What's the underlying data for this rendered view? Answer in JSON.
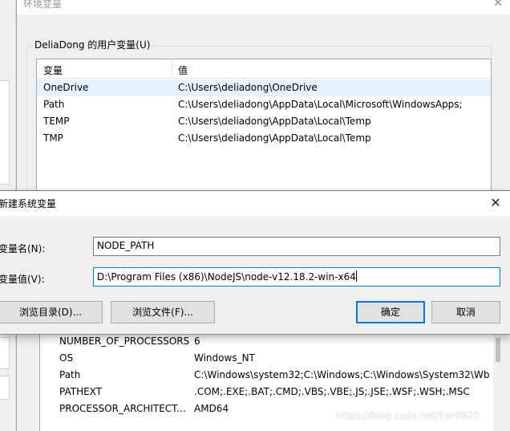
{
  "env_window": {
    "title": "环境变量",
    "close_glyph": "✕",
    "user_group_label": "DeliaDong 的用户变量(U)",
    "columns": {
      "name": "变量",
      "value": "值"
    },
    "user_vars": [
      {
        "name": "OneDrive",
        "value": "C:\\Users\\deliadong\\OneDrive"
      },
      {
        "name": "Path",
        "value": "C:\\Users\\deliadong\\AppData\\Local\\Microsoft\\WindowsApps;"
      },
      {
        "name": "TEMP",
        "value": "C:\\Users\\deliadong\\AppData\\Local\\Temp"
      },
      {
        "name": "TMP",
        "value": "C:\\Users\\deliadong\\AppData\\Local\\Temp"
      }
    ],
    "system_vars": [
      {
        "name": "NUMBER_OF_PROCESSORS",
        "value": "6"
      },
      {
        "name": "OS",
        "value": "Windows_NT"
      },
      {
        "name": "Path",
        "value": "C:\\Windows\\system32;C:\\Windows;C:\\Windows\\System32\\Wb..."
      },
      {
        "name": "PATHEXT",
        "value": ".COM;.EXE;.BAT;.CMD;.VBS;.VBE;.JS;.JSE;.WSF;.WSH;.MSC"
      },
      {
        "name": "PROCESSOR_ARCHITECT...",
        "value": "AMD64"
      }
    ],
    "watermark": "https://blog.csdn.net/Ear0920"
  },
  "dialog": {
    "title": "新建系统变量",
    "close_glyph": "✕",
    "name_label": "变量名(N):",
    "name_value": "NODE_PATH",
    "value_label": "变量值(V):",
    "value_value": "D:\\Program Files (x86)\\NodeJS\\node-v12.18.2-win-x64",
    "browse_dir_label": "浏览目录(D)...",
    "browse_file_label": "浏览文件(F)...",
    "ok_label": "确定",
    "cancel_label": "取消"
  },
  "colors": {
    "accent": "#0078d7",
    "window_bg": "#f0f0f0",
    "selected_row": "#e5f3ff"
  }
}
